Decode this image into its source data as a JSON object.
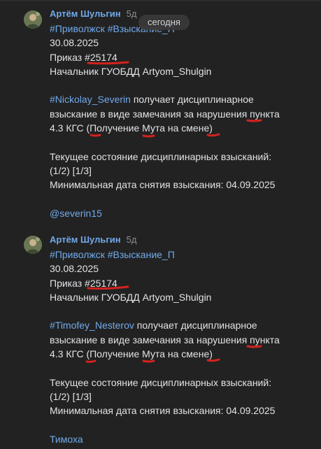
{
  "date_separator": "сегодня",
  "messages": [
    {
      "author": "Артём Шульгин",
      "time": "5д",
      "hashtags": "#Приволжск #Взыскание_П",
      "date": "30.08.2025",
      "order_prefix": "Приказ ",
      "order_number": "#25174",
      "signature": "Начальник ГУОБДД Artyom_Shulgin",
      "target_tag": "#Nickolay_Severin",
      "penalty_line1_rest": " получает дисциплинарное",
      "penalty_line2": "взыскание в виде замечания за нарушения пункта",
      "penalty_line3": "4.3 КГС (Получение Мута на смене)",
      "status_line1": "Текущее состояние дисциплинарных взысканий:",
      "status_line2": "(1/2) [1/3]",
      "status_line3": "Минимальная дата снятия взыскания: 04.09.2025",
      "mention": "@severin15"
    },
    {
      "author": "Артём Шульгин",
      "time": "5д",
      "hashtags": "#Приволжск #Взыскание_П",
      "date": "30.08.2025",
      "order_prefix": "Приказ ",
      "order_number": "#25174",
      "signature": "Начальник ГУОБДД Artyom_Shulgin",
      "target_tag": "#Timofey_Nesterov",
      "penalty_line1_rest": " получает дисциплинарное",
      "penalty_line2": "взыскание в виде замечания за нарушения пункта",
      "penalty_line3": "4.3 КГС (Получение Мута на смене)",
      "status_line1": "Текущее состояние дисциплинарных взысканий:",
      "status_line2": "(1/2) [1/3]",
      "status_line3": "Минимальная дата снятия взыскания: 04.09.2025",
      "mention": "Тимоха"
    }
  ],
  "colors": {
    "background": "#222222",
    "text": "#e1e3e6",
    "link": "#71aaeb",
    "muted": "#8a8e93",
    "annotation": "#d3231f"
  }
}
